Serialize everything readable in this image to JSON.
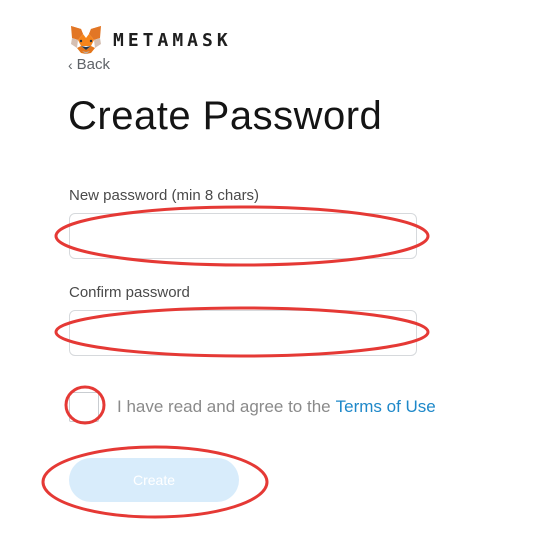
{
  "brand": {
    "name": "METAMASK"
  },
  "nav": {
    "back_label": "Back",
    "back_glyph": "‹"
  },
  "page": {
    "title": "Create Password"
  },
  "form": {
    "new_password_label": "New password (min 8 chars)",
    "new_password_value": "",
    "confirm_password_label": "Confirm password",
    "confirm_password_value": "",
    "agree_text": "I have read and agree to the",
    "terms_link": "Terms of Use",
    "agree_checked": false,
    "create_button": "Create"
  },
  "colors": {
    "accent": "#1e88c9",
    "button_disabled_bg": "#d8ecfb",
    "annotation_red": "#e53935"
  }
}
